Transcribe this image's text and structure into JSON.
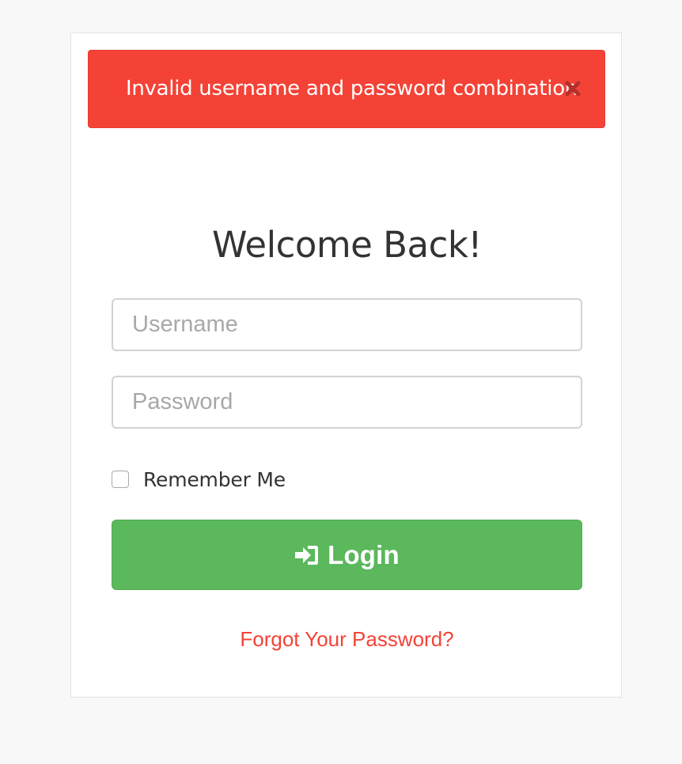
{
  "alert": {
    "message": "Invalid username and password combination",
    "close_icon": "close-icon",
    "color": "#f44236"
  },
  "heading": {
    "title": "Welcome Back!"
  },
  "form": {
    "username_placeholder": "Username",
    "username_value": "",
    "password_placeholder": "Password",
    "password_value": "",
    "remember_label": "Remember Me",
    "remember_checked": false,
    "login_label": "Login",
    "login_icon": "sign-in-icon",
    "login_color": "#5cb85c",
    "forgot_label": "Forgot Your Password?"
  }
}
